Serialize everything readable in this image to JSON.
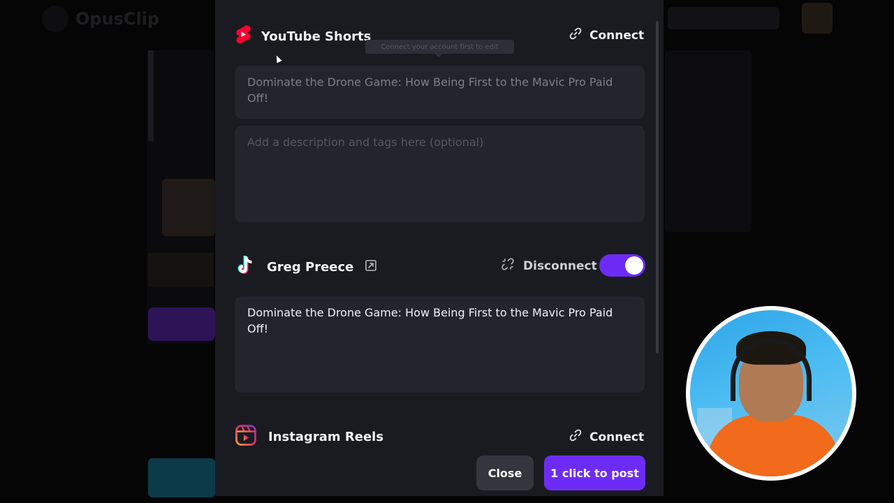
{
  "background": {
    "logo_text": "OpusClip"
  },
  "platforms": [
    {
      "name": "YouTube Shorts",
      "icon": "youtube-shorts-icon",
      "action_label": "Connect",
      "action_icon": "link-icon",
      "tooltip": "Connect your account first to edit",
      "title_value": "Dominate the Drone Game: How Being First to the Mavic Pro Paid Off!",
      "description_placeholder": "Add a description and tags here (optional)"
    },
    {
      "name": "Greg Preece",
      "icon": "tiktok-icon",
      "secondary_icon": "external-link-icon",
      "action_label": "Disconnect",
      "action_icon": "unlink-icon",
      "enabled": true,
      "caption_value": "Dominate the Drone Game: How Being First to the Mavic Pro Paid Off!"
    },
    {
      "name": "Instagram Reels",
      "icon": "instagram-reels-icon",
      "action_label": "Connect",
      "action_icon": "link-icon"
    }
  ],
  "footer": {
    "close_label": "Close",
    "post_label": "1 click to post"
  },
  "colors": {
    "accent": "#6d2cf5",
    "modal_bg": "#1a1b21",
    "field_bg": "#24252c",
    "youtube_red": "#ff0033"
  }
}
